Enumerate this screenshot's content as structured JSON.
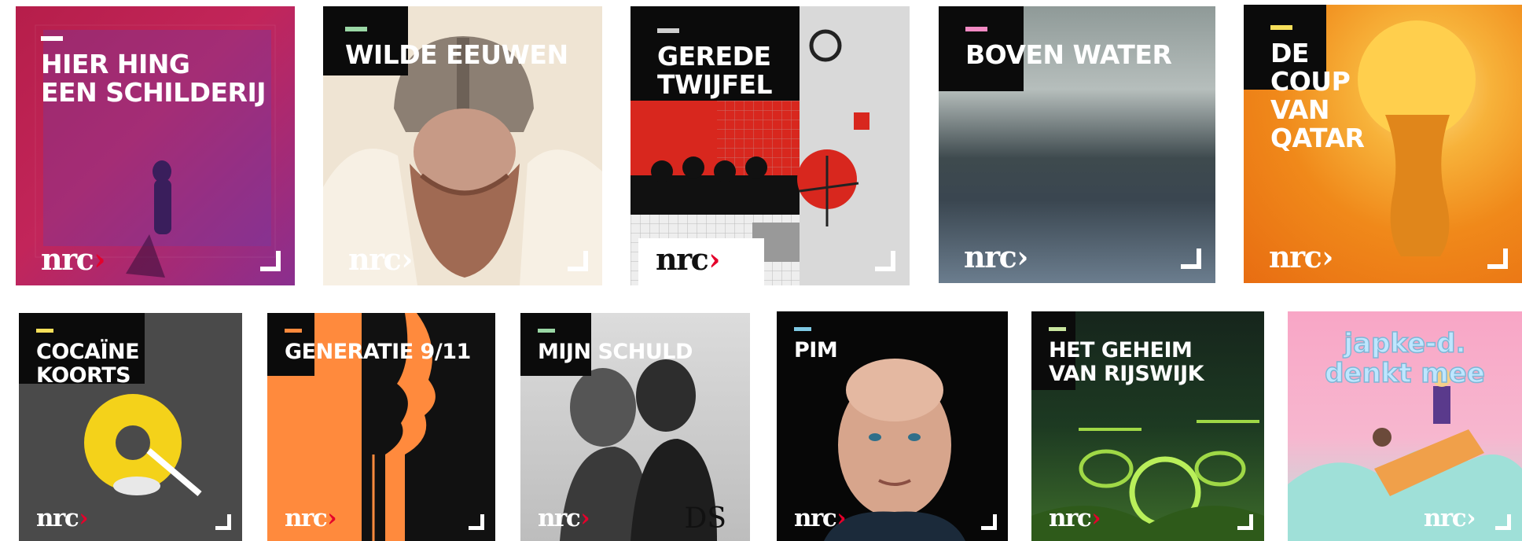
{
  "brand": {
    "wordmark": "nrc",
    "chevron": "›"
  },
  "row1": [
    {
      "id": "hier-hing",
      "title": "HIER HING\nEEN SCHILDERIJ",
      "dash": "#ffffff"
    },
    {
      "id": "wilde-eeuwen",
      "title": "WILDE EEUWEN",
      "dash": "#9ad7a5"
    },
    {
      "id": "gerede-twijfel",
      "title": "GEREDE\nTWIJFEL",
      "dash": "#cfcfcf"
    },
    {
      "id": "boven-water",
      "title": "BOVEN WATER",
      "dash": "#f28ac3"
    },
    {
      "id": "coup-qatar",
      "title": "DE\nCOUP\nVAN\nQATAR",
      "dash": "#f6df5a"
    }
  ],
  "row2": [
    {
      "id": "cocaine",
      "title": "COCAÏNE\nKOORTS",
      "dash": "#f6df5a"
    },
    {
      "id": "generatie",
      "title": "GENERATIE 9/11",
      "dash": "#ff8a3d"
    },
    {
      "id": "mijn-schuld",
      "title": "MIJN SCHULD",
      "dash": "#9ad7a5",
      "extra": "DS"
    },
    {
      "id": "pim",
      "title": "PIM",
      "dash": "#7ec8e3"
    },
    {
      "id": "geheim",
      "title": "HET GEHEIM\nVAN RIJSWIJK",
      "dash": "#c9e6a0"
    },
    {
      "id": "japke",
      "title": "japke-d.\ndenkt mee"
    }
  ],
  "colors": {
    "nrc_red": "#e4002b"
  }
}
